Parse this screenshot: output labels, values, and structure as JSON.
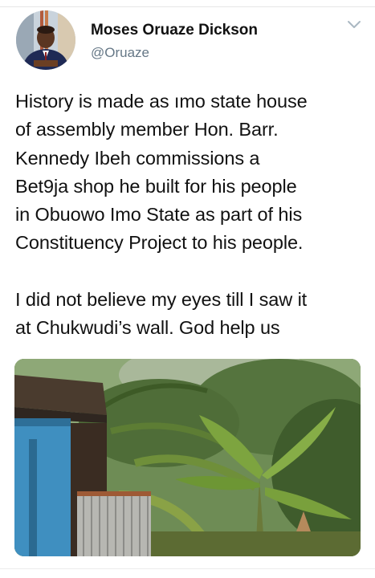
{
  "tweet": {
    "author": {
      "display_name": "Moses Oruaze Dickson",
      "handle": "@Oruaze"
    },
    "text": {
      "paragraph_1": [
        "History is made as ımo state house",
        "of assembly member Hon. Barr.",
        "Kennedy Ibeh  commissions a",
        "Bet9ja  shop he built for his people",
        "in Obuowo Imo State  as part of his",
        "Constituency Project to his people."
      ],
      "paragraph_2": [
        "I did not believe my eyes till I saw it",
        "at Chukwudi’s wall. God help us"
      ]
    },
    "menu_icon": "chevron-down-icon",
    "media": {
      "kind": "photo"
    }
  },
  "colors": {
    "text": "#111111",
    "handle": "#657786",
    "chevron": "#aab8c2",
    "shop_wall": "#3f8fc0"
  }
}
